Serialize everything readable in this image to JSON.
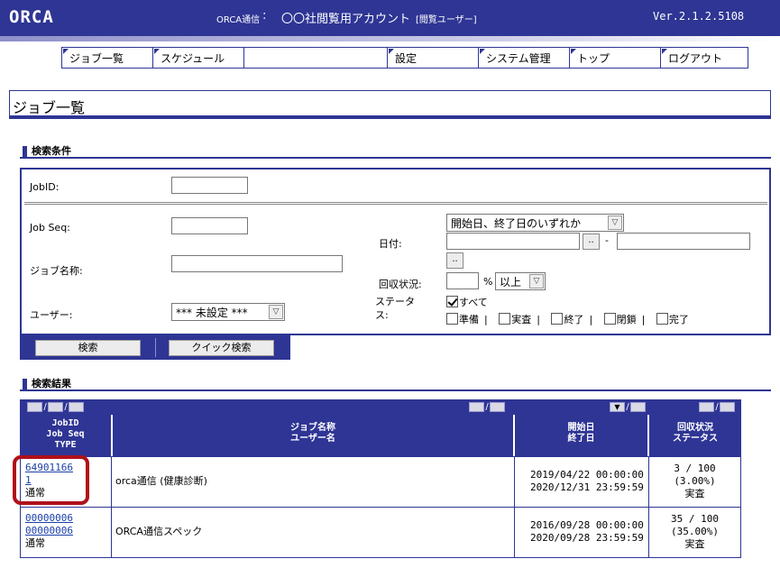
{
  "header": {
    "logo": "ORCA",
    "app_name": "ORCA通信",
    "separator": ":",
    "account": "〇〇社閲覧用アカウント",
    "role": "[閲覧ユーザー]",
    "version": "Ver.2.1.2.5108"
  },
  "nav": {
    "items": [
      {
        "label": "ジョブ一覧"
      },
      {
        "label": "スケジュール"
      },
      {
        "label": ""
      },
      {
        "label": "設定"
      },
      {
        "label": "システム管理"
      },
      {
        "label": "トップ"
      },
      {
        "label": "ログアウト"
      }
    ]
  },
  "page_title": "ジョブ一覧",
  "search": {
    "section_title": "検索条件",
    "jobid_label": "JobID:",
    "jobid_value": "",
    "jobseq_label": "Job Seq:",
    "jobseq_value": "",
    "jobname_label": "ジョブ名称:",
    "jobname_value": "",
    "user_label": "ユーザー:",
    "user_selected": "*** 未設定 ***",
    "date_label": "日付:",
    "date_mode_selected": "開始日、終了日のいずれか",
    "date_from": "",
    "date_to": "",
    "date_dash": "-",
    "picker_glyph": "..",
    "collect_label": "回収状況:",
    "collect_value": "",
    "percent_sign": "%",
    "collect_mode_selected": "以上",
    "status_label": "ステータス:",
    "status_all": "すべて",
    "status_options": [
      "準備",
      "実査",
      "終了",
      "閉鎖",
      "完了"
    ],
    "separator_glyph": "|",
    "arrow_glyph": "▽",
    "search_button": "検索",
    "quick_search_button": "クイック検索"
  },
  "results": {
    "section_title": "検索結果",
    "sort_slash": "/",
    "sort_active_glyph": "▼",
    "columns": {
      "id": [
        "JobID",
        "Job Seq",
        "TYPE"
      ],
      "name": [
        "ジョブ名称",
        "ユーザー名"
      ],
      "period": [
        "開始日",
        "終了日"
      ],
      "status": [
        "回収状況",
        "ステータス"
      ]
    },
    "rows": [
      {
        "jobid": "64901166",
        "jobseq": "1",
        "type": "通常",
        "name": "orca通信 (健康診断)",
        "start": "2019/04/22 00:00:00",
        "end": "2020/12/31 23:59:59",
        "collect": "3 / 100",
        "rate": "(3.00%)",
        "status": "実査"
      },
      {
        "jobid": "00000006",
        "jobseq": "00000006",
        "type": "通常",
        "name": "ORCA通信スペック",
        "start": "2016/09/28 00:00:00",
        "end": "2020/09/28 23:59:59",
        "collect": "35 / 100",
        "rate": "(35.00%)",
        "status": "実査"
      }
    ]
  }
}
